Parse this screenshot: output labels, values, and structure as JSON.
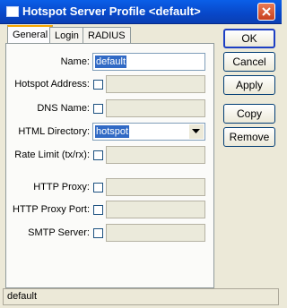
{
  "window": {
    "title": "Hotspot Server Profile <default>"
  },
  "tabs": [
    {
      "label": "General",
      "active": true
    },
    {
      "label": "Login",
      "active": false
    },
    {
      "label": "RADIUS",
      "active": false
    }
  ],
  "form": {
    "name": {
      "label": "Name:",
      "value": "default"
    },
    "hotspot_address": {
      "label": "Hotspot Address:",
      "value": ""
    },
    "dns_name": {
      "label": "DNS Name:",
      "value": ""
    },
    "html_directory": {
      "label": "HTML Directory:",
      "value": "hotspot"
    },
    "rate_limit": {
      "label": "Rate Limit (tx/rx):",
      "value": ""
    },
    "http_proxy": {
      "label": "HTTP Proxy:",
      "value": ""
    },
    "http_proxy_port": {
      "label": "HTTP Proxy Port:",
      "value": ""
    },
    "smtp_server": {
      "label": "SMTP Server:",
      "value": ""
    }
  },
  "buttons": {
    "ok": "OK",
    "cancel": "Cancel",
    "apply": "Apply",
    "copy": "Copy",
    "remove": "Remove"
  },
  "status": {
    "text": "default"
  },
  "colors": {
    "titlebar": "#0a5fe8",
    "selection": "#316ac5",
    "window": "#ece9d8"
  }
}
